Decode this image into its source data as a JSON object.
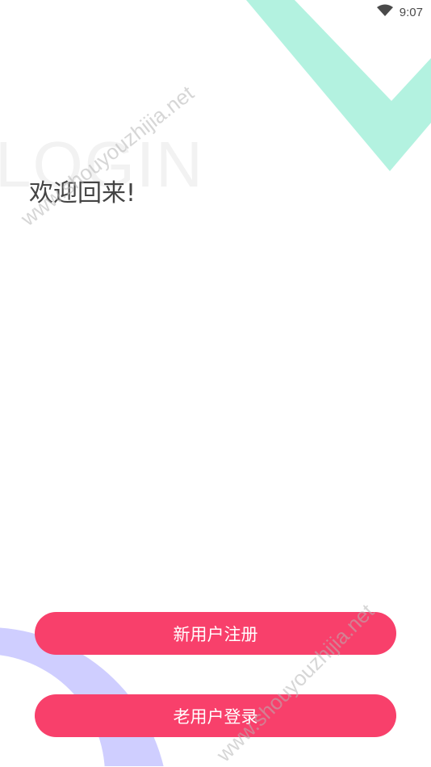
{
  "status_bar": {
    "time": "9:07",
    "wifi_icon": "wifi-icon"
  },
  "background_text": "LOGIN",
  "welcome_text": "欢迎回来!",
  "watermark": "www.shouyouzhijia.net",
  "buttons": {
    "register": "新用户注册",
    "login": "老用户登录"
  },
  "colors": {
    "accent": "#f8406b",
    "mint_decoration": "#b3f2e0",
    "lavender_decoration": "#cfceff"
  }
}
